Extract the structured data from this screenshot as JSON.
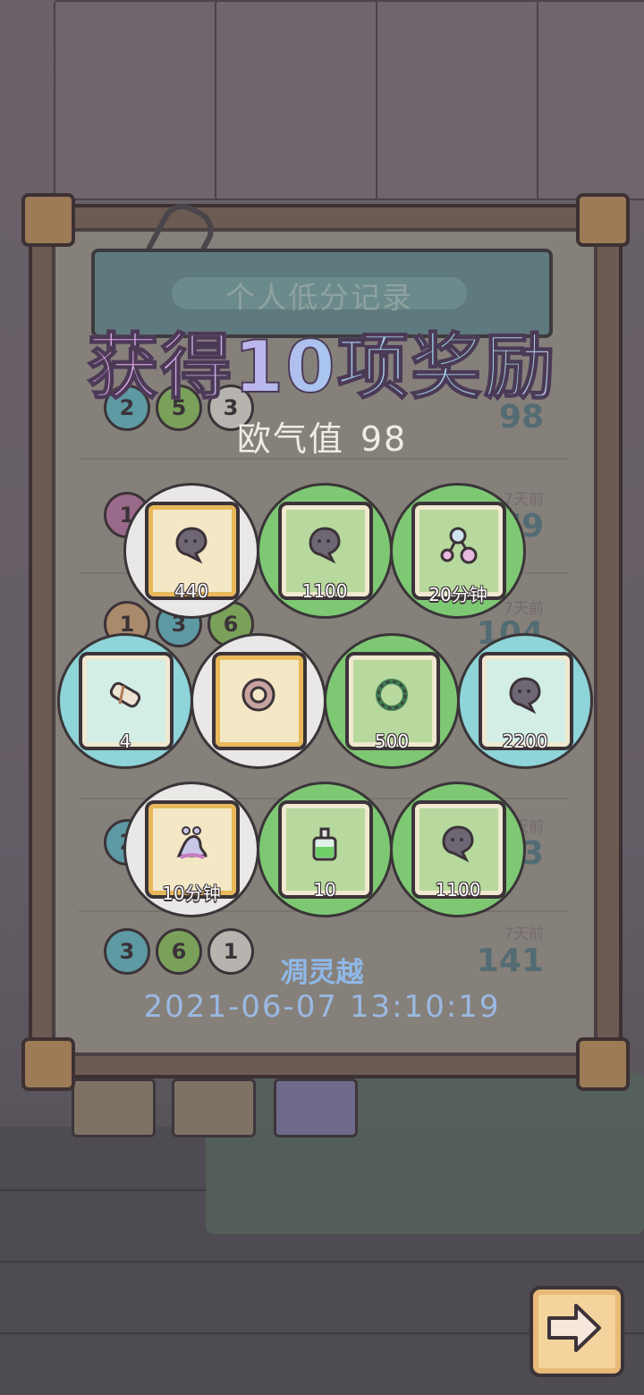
{
  "board": {
    "header": "个人低分记录",
    "rows": [
      {
        "balls": [
          "2",
          "5",
          "3"
        ],
        "score": "98",
        "days": ""
      },
      {
        "balls": [
          "1",
          "",
          ""
        ],
        "score": "79",
        "days": "7天前"
      },
      {
        "balls": [
          "1",
          "3",
          "6"
        ],
        "score": "104",
        "days": "7天前"
      },
      {
        "balls": [
          "2",
          "",
          ""
        ],
        "score": "73",
        "days": "7天前"
      },
      {
        "balls": [
          "3",
          "6",
          "1"
        ],
        "score": "141",
        "days": "7天前"
      }
    ]
  },
  "overlay": {
    "title": "获得10项奖励",
    "luck_label": "欧气值",
    "luck_value": "98",
    "player": "凋灵越",
    "timestamp": "2021-06-07 13:10:19"
  },
  "rewards": [
    {
      "icon": "ghost-blob-icon",
      "qty": "440",
      "rarity": "white"
    },
    {
      "icon": "ghost-blob-icon",
      "qty": "1100",
      "rarity": "green"
    },
    {
      "icon": "molecule-potion-icon",
      "qty": "20分钟",
      "rarity": "green"
    },
    {
      "icon": "scroll-icon",
      "qty": "4",
      "rarity": "blue"
    },
    {
      "icon": "ring-icon",
      "qty": "",
      "rarity": "white"
    },
    {
      "icon": "vine-wreath-icon",
      "qty": "500",
      "rarity": "green"
    },
    {
      "icon": "ghost-blob-icon",
      "qty": "2200",
      "rarity": "blue"
    },
    {
      "icon": "slug-creature-icon",
      "qty": "10分钟",
      "rarity": "white"
    },
    {
      "icon": "green-potion-icon",
      "qty": "10",
      "rarity": "green"
    },
    {
      "icon": "ghost-blob-icon",
      "qty": "1100",
      "rarity": "green"
    }
  ],
  "controls": {
    "next_icon": "arrow-right-icon"
  },
  "colors": {
    "white_rarity": "#e9e8e6",
    "green_rarity": "#7ec874",
    "blue_rarity": "#8ed4d8"
  }
}
